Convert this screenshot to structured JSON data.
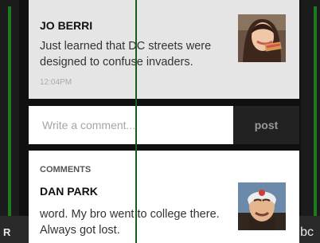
{
  "feed_item": {
    "author": "JO BERRI",
    "text": "Just learned that DC streets were designed to confuse invaders.",
    "time": "12:04PM"
  },
  "comment_box": {
    "placeholder": "Write a comment...",
    "post_label": "post"
  },
  "comments_section": {
    "header": "COMMENTS",
    "items": [
      {
        "author": "DAN PARK",
        "text": "word. My bro went to college there. Always got lost."
      }
    ]
  },
  "background": {
    "bottom_left_label": "R",
    "bottom_right_label": "bc"
  },
  "colors": {
    "accent_green": "#1e7a1e",
    "card_gray": "#e5e5e5",
    "post_button_bg": "#222222"
  }
}
